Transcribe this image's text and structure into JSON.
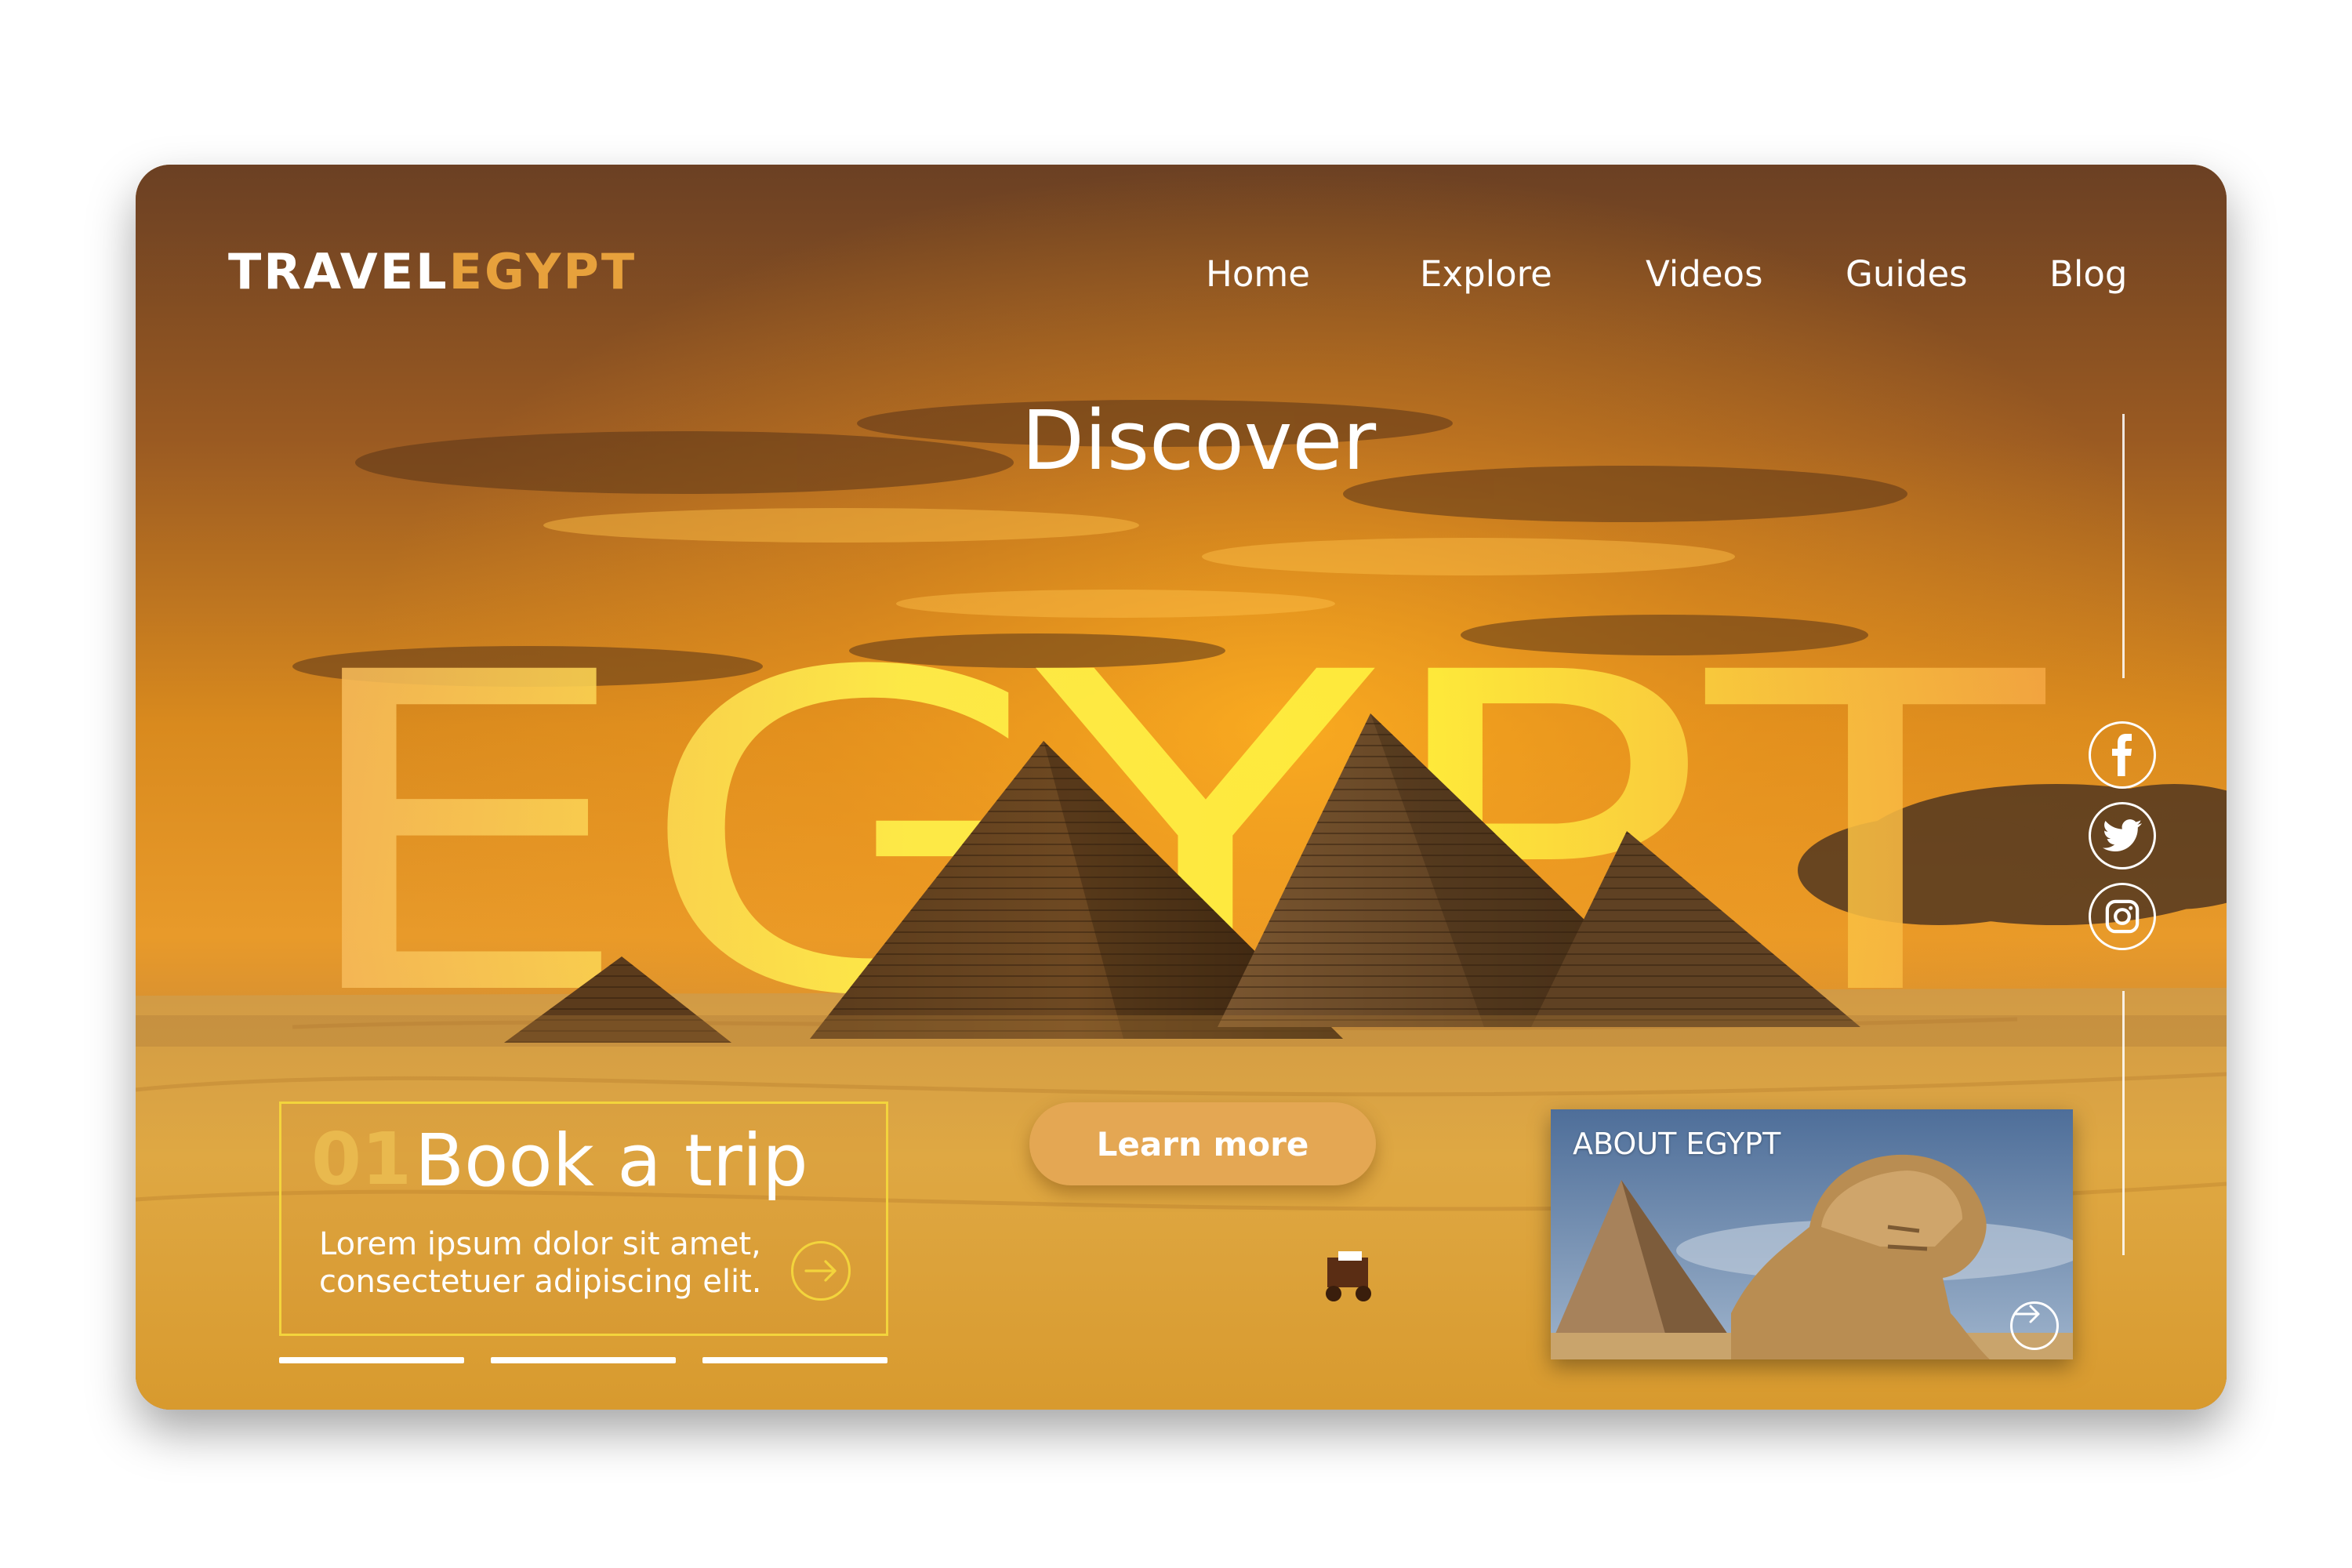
{
  "brand": {
    "part1": "TRAVEL",
    "part2": "EGYPT",
    "accent_color": "#e7a13c"
  },
  "nav": {
    "items": [
      {
        "label": "Home"
      },
      {
        "label": "Explore"
      },
      {
        "label": "Videos"
      },
      {
        "label": "Guides"
      },
      {
        "label": "Blog"
      }
    ]
  },
  "hero": {
    "eyebrow": "Discover",
    "headline": "EGYPT",
    "headline_color": "#f4e23a"
  },
  "social": {
    "icons": [
      "facebook-icon",
      "twitter-icon",
      "instagram-icon"
    ]
  },
  "book": {
    "number": "01",
    "title": "Book a trip",
    "description_line1": "Lorem ipsum dolor sit amet,",
    "description_line2": "consectetuer adipiscing elit.",
    "border_color": "#f3d43c",
    "arrow_icon": "arrow-right-icon"
  },
  "slider": {
    "count": 3
  },
  "cta": {
    "label": "Learn more",
    "color": "#e4a753"
  },
  "about": {
    "label": "ABOUT EGYPT",
    "arrow_icon": "arrow-right-icon"
  }
}
